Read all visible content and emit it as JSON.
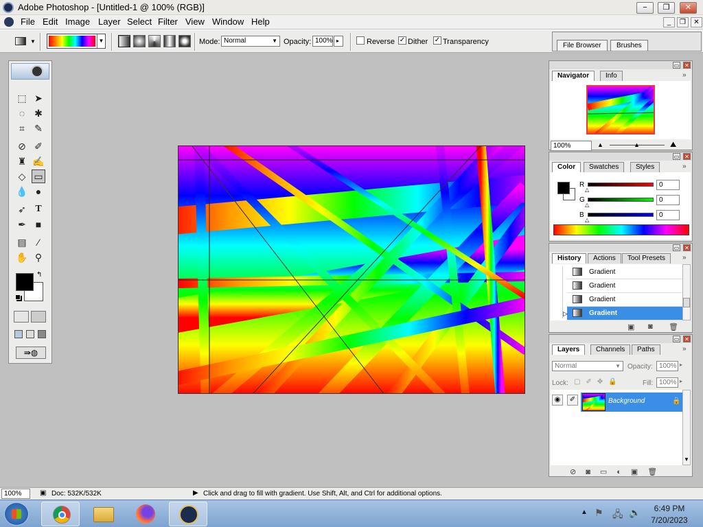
{
  "window": {
    "title": "Adobe Photoshop - [Untitled-1 @ 100% (RGB)]",
    "minimize": "−",
    "maximize": "❐",
    "close": "✕"
  },
  "menu": [
    "File",
    "Edit",
    "Image",
    "Layer",
    "Select",
    "Filter",
    "View",
    "Window",
    "Help"
  ],
  "mdi_controls": {
    "minimize": "_",
    "restore": "❐",
    "close": "✕"
  },
  "options": {
    "mode_label": "Mode:",
    "mode_value": "Normal",
    "opacity_label": "Opacity:",
    "opacity_value": "100%",
    "reverse_label": "Reverse",
    "reverse_checked": false,
    "dither_label": "Dither",
    "dither_checked": true,
    "transparency_label": "Transparency",
    "transparency_checked": true,
    "well_tabs": [
      "File Browser",
      "Brushes"
    ]
  },
  "navigator": {
    "tabs": [
      "Navigator",
      "Info"
    ],
    "zoom": "100%"
  },
  "color": {
    "tabs": [
      "Color",
      "Swatches",
      "Styles"
    ],
    "channels": [
      {
        "label": "R",
        "value": "0",
        "color": "#d32020"
      },
      {
        "label": "G",
        "value": "0",
        "color": "#20b020"
      },
      {
        "label": "B",
        "value": "0",
        "color": "#2020c8"
      }
    ]
  },
  "history": {
    "tabs": [
      "History",
      "Actions",
      "Tool Presets"
    ],
    "items": [
      {
        "label": "Gradient",
        "selected": false
      },
      {
        "label": "Gradient",
        "selected": false
      },
      {
        "label": "Gradient",
        "selected": false
      },
      {
        "label": "Gradient",
        "selected": true
      }
    ]
  },
  "layers": {
    "tabs": [
      "Layers",
      "Channels",
      "Paths"
    ],
    "blend_mode": "Normal",
    "opacity_label": "Opacity:",
    "opacity_value": "100%",
    "lock_label": "Lock:",
    "fill_label": "Fill:",
    "fill_value": "100%",
    "layer_name": "Background"
  },
  "status": {
    "zoom": "100%",
    "doc": "Doc: 532K/532K",
    "hint": "Click and drag to fill with gradient.  Use Shift, Alt, and Ctrl for additional options."
  },
  "taskbar": {
    "time": "6:49 PM",
    "date": "7/20/2023"
  }
}
